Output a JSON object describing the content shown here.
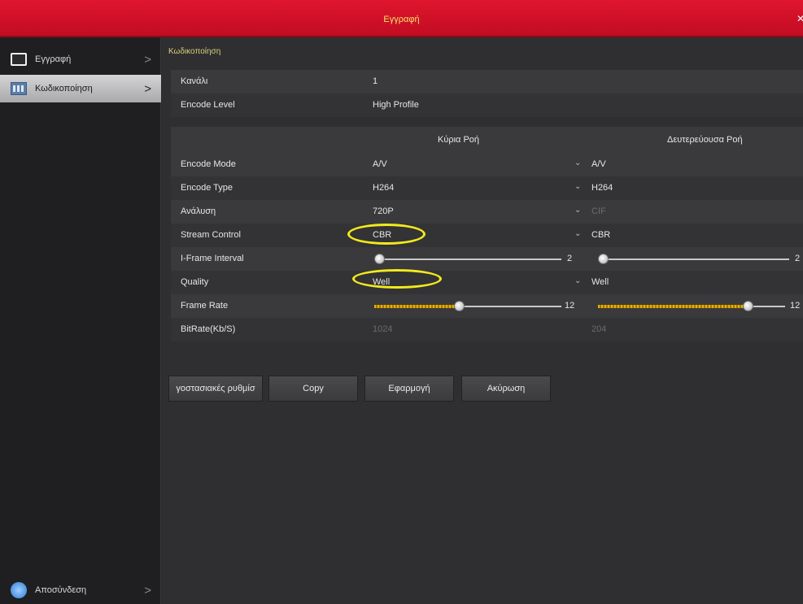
{
  "window": {
    "title": "Εγγραφή",
    "close": "✕"
  },
  "sidebar": {
    "items": [
      {
        "label": "Εγγραφή",
        "icon": "monitor-icon"
      },
      {
        "label": "Κωδικοποίηση",
        "icon": "grid-icon"
      }
    ],
    "bottom": {
      "label": "Αποσύνδεση",
      "icon": "logout-icon"
    },
    "arrow": ">"
  },
  "main": {
    "section_title": "Κωδικοποίηση",
    "channel": {
      "label": "Κανάλι",
      "value": "1"
    },
    "encode_level": {
      "label": "Encode Level",
      "value": "High Profile"
    },
    "columns": {
      "main": "Κύρια Ροή",
      "sub": "Δευτερεύουσα Ροή"
    },
    "rows": [
      {
        "label": "Encode Mode",
        "main": "A/V",
        "sub": "A/V"
      },
      {
        "label": "Encode Type",
        "main": "H264",
        "sub": "H264"
      },
      {
        "label": "Ανάλυση",
        "main": "720P",
        "sub": "CIF"
      },
      {
        "label": "Stream Control",
        "main": "CBR",
        "sub": "CBR"
      },
      {
        "label": "I-Frame Interval",
        "main": "2",
        "sub": "2",
        "main_fraction": 0.0,
        "sub_fraction": 0.0
      },
      {
        "label": "Quality",
        "main": "Well",
        "sub": "Well"
      },
      {
        "label": "Frame Rate",
        "main": "12",
        "sub": "12",
        "main_fraction": 0.45,
        "sub_fraction": 0.8
      },
      {
        "label": "BitRate(Kb/S)",
        "main": "1024",
        "sub": "204"
      }
    ],
    "chevron": "⌄"
  },
  "buttons": {
    "defaults": "γοστασιακές ρυθμίσ",
    "copy": "Copy",
    "apply": "Εφαρμογή",
    "cancel": "Ακύρωση"
  },
  "colors": {
    "titlebar": "#d4142b",
    "highlight": "#f2ea1c",
    "slider_fill": "#e7b000"
  }
}
